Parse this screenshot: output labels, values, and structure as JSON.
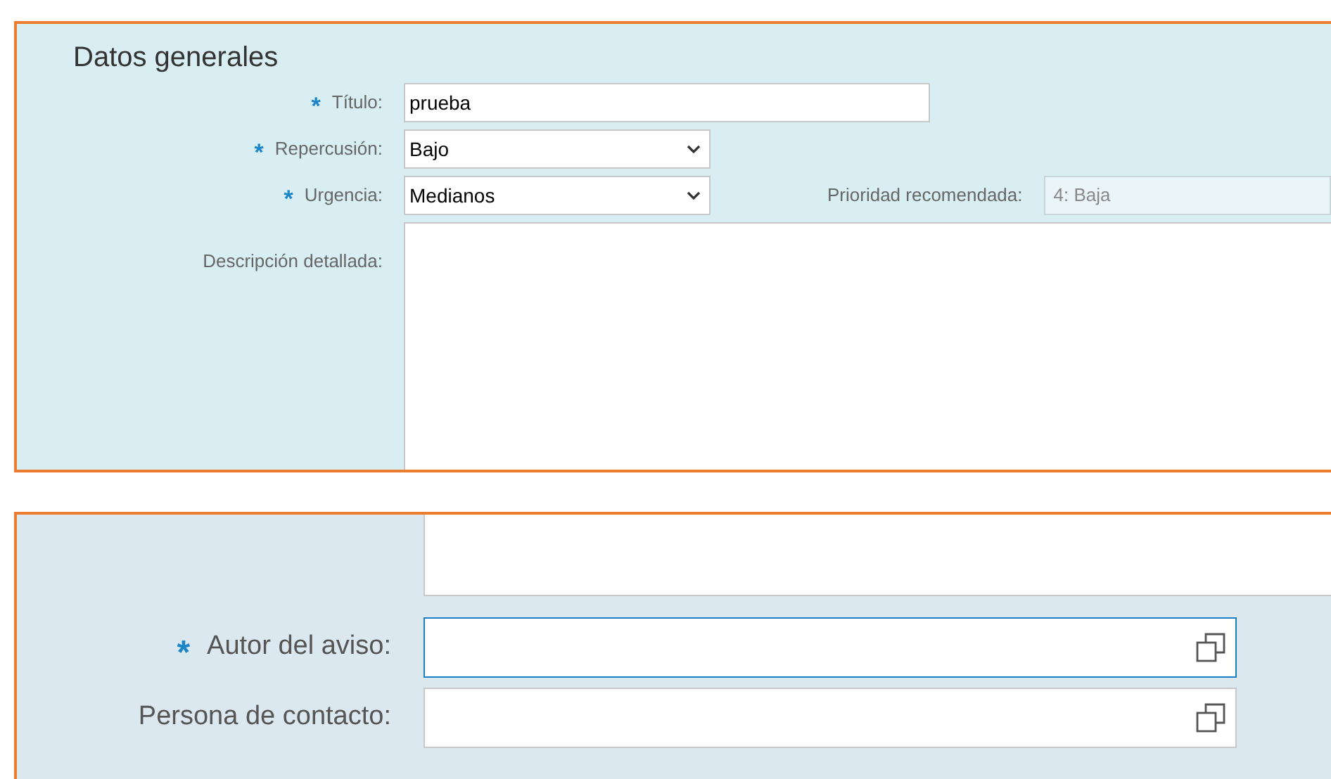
{
  "general": {
    "title": "Datos generales",
    "fields": [
      {
        "kind": "text",
        "label": "Título:",
        "required_mark": "*",
        "value": "prueba"
      },
      {
        "kind": "select",
        "label": "Repercusión:",
        "required_mark": "*",
        "value": "Bajo"
      },
      {
        "kind": "select",
        "label": "Urgencia:",
        "required_mark": "*",
        "value": "Medianos",
        "extra": {
          "label": "Prioridad recomendada:",
          "value": "4: Baja",
          "disabled": true
        }
      },
      {
        "kind": "textarea",
        "label": "Descripción detallada:"
      }
    ]
  },
  "contacts": {
    "fields": [
      {
        "kind": "textarea"
      },
      {
        "kind": "lookup",
        "label": "Autor del aviso:",
        "required_mark": "*",
        "focused": true
      },
      {
        "kind": "lookup",
        "label": "Persona de contacto:",
        "focused": false
      }
    ]
  }
}
